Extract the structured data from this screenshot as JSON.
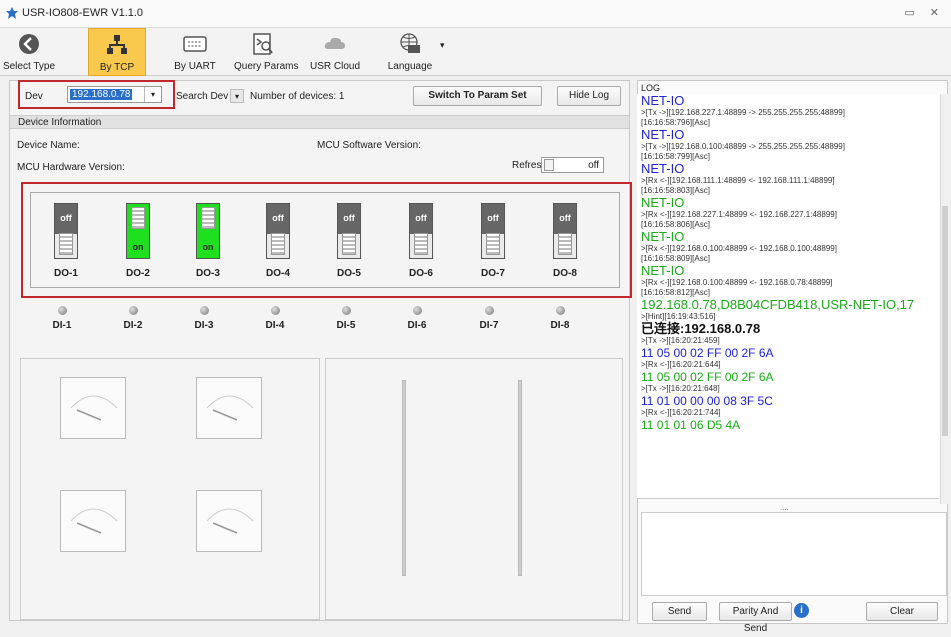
{
  "window": {
    "title": "USR-IO808-EWR V1.1.0",
    "controls": "▭ ✕"
  },
  "toolbar": [
    {
      "label": "Select Type",
      "icon": "back-arrow-icon"
    },
    {
      "label": "By TCP",
      "icon": "network-icon",
      "active": true
    },
    {
      "label": "By UART",
      "icon": "keyboard-icon"
    },
    {
      "label": "Query Params",
      "icon": "query-icon"
    },
    {
      "label": "USR Cloud",
      "icon": "cloud-icon"
    },
    {
      "label": "Language",
      "icon": "globe-icon"
    }
  ],
  "device_bar": {
    "dev_label": "Dev",
    "dev_value": "192.168.0.78",
    "search_label": "Search Dev",
    "device_count": "Number of devices: 1",
    "switch_button": "Switch To Param Set",
    "hide_log_button": "Hide Log"
  },
  "device_info": {
    "section_title": "Device Information",
    "device_name": "Device Name:",
    "mcu_software": "MCU Software Version:",
    "mcu_hardware": "MCU Hardware Version:",
    "refresh_label": "Refresh",
    "refresh_state": "off"
  },
  "outputs": [
    {
      "name": "DO-1",
      "state": "off"
    },
    {
      "name": "DO-2",
      "state": "on"
    },
    {
      "name": "DO-3",
      "state": "on"
    },
    {
      "name": "DO-4",
      "state": "off"
    },
    {
      "name": "DO-5",
      "state": "off"
    },
    {
      "name": "DO-6",
      "state": "off"
    },
    {
      "name": "DO-7",
      "state": "off"
    },
    {
      "name": "DO-8",
      "state": "off"
    }
  ],
  "inputs": [
    "DI-1",
    "DI-2",
    "DI-3",
    "DI-4",
    "DI-5",
    "DI-6",
    "DI-7",
    "DI-8"
  ],
  "log": {
    "title": "LOG",
    "entries": [
      {
        "text": "NET-IO",
        "style": "big"
      },
      {
        "text": ">[Tx ->][192.168.227.1:48899 -> 255.255.255.255:48899]",
        "style": "small"
      },
      {
        "text": "[16:16:58:796][Asc]",
        "style": "small"
      },
      {
        "text": "NET-IO",
        "style": "big"
      },
      {
        "text": ">[Tx ->][192.168.0.100:48899 -> 255.255.255.255:48899]",
        "style": "small"
      },
      {
        "text": "[16:16:58:799][Asc]",
        "style": "small"
      },
      {
        "text": "NET-IO",
        "style": "big"
      },
      {
        "text": ">[Rx <-][192.168.111.1:48899 <- 192.168.111.1:48899]",
        "style": "small"
      },
      {
        "text": "[16:16:58:803][Asc]",
        "style": "small"
      },
      {
        "text": "NET-IO",
        "style": "big green"
      },
      {
        "text": ">[Rx <-][192.168.227.1:48899 <- 192.168.227.1:48899]",
        "style": "small"
      },
      {
        "text": "[16:16:58:806][Asc]",
        "style": "small"
      },
      {
        "text": "NET-IO",
        "style": "big green"
      },
      {
        "text": ">[Rx <-][192.168.0.100:48899 <- 192.168.0.100:48899]",
        "style": "small"
      },
      {
        "text": "[16:16:58:809][Asc]",
        "style": "small"
      },
      {
        "text": "NET-IO",
        "style": "big green"
      },
      {
        "text": ">[Rx <-][192.168.0.100:48899 <- 192.168.0.78:48899]",
        "style": "small"
      },
      {
        "text": "[16:16:58:812][Asc]",
        "style": "small"
      },
      {
        "text": "192.168.0.78,D8B04CFDB418,USR-NET-IO,17",
        "style": "big green"
      },
      {
        "text": ">[Hint][16:19:43:516]",
        "style": "small"
      },
      {
        "text": "已连接:192.168.0.78",
        "style": "big black"
      },
      {
        "text": ">[Tx ->][16:20:21:459]",
        "style": "small"
      },
      {
        "text": "11 05 00 02 FF 00 2F 6A",
        "style": "big hex"
      },
      {
        "text": ">[Rx <-][16:20:21:644]",
        "style": "small"
      },
      {
        "text": "11 05 00 02 FF 00 2F 6A",
        "style": "big green hex"
      },
      {
        "text": ">[Tx ->][16:20:21:648]",
        "style": "small"
      },
      {
        "text": "11 01 00 00 00 08 3F 5C",
        "style": "big hex"
      },
      {
        "text": ">[Rx <-][16:20:21:744]",
        "style": "small"
      },
      {
        "text": "11 01 01 06 D5 4A",
        "style": "big green hex"
      }
    ],
    "send_button": "Send",
    "parity_button": "Parity And Send",
    "clear_button": "Clear",
    "splitter": "....",
    "info_icon_text": "i"
  },
  "colors": {
    "active_tab": "#f9c94d",
    "relay_on": "#1ee01e",
    "relay_off": "#666666",
    "highlight": "#c0282d",
    "log_tx": "#2222dd",
    "log_rx": "#1aaa1a"
  }
}
